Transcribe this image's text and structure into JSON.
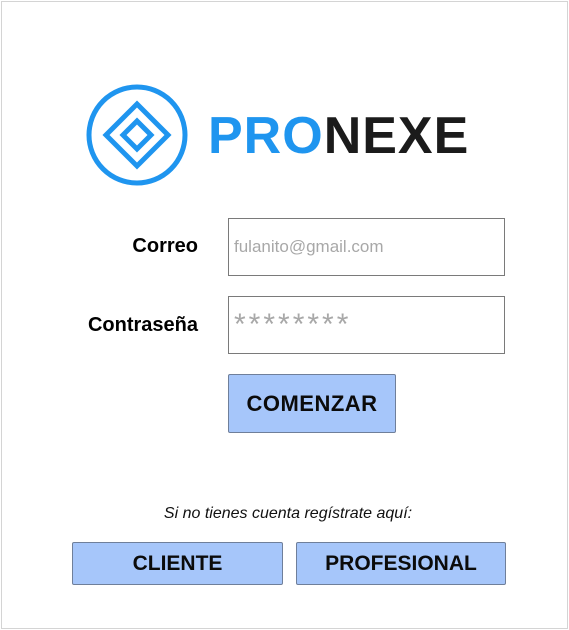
{
  "brand": {
    "name_part1": "PRO",
    "name_part2": "NEXE",
    "logo_icon": "diamond-circle-logo",
    "primary_color": "#1f95ef",
    "dark_color": "#1b1b1b"
  },
  "login": {
    "email_label": "Correo",
    "email_placeholder": "fulanito@gmail.com",
    "email_value": "",
    "password_label": "Contraseña",
    "password_value": "********",
    "submit_label": "COMENZAR"
  },
  "register": {
    "prompt": "Si no tienes cuenta regístrate aquí:",
    "client_label": "CLIENTE",
    "professional_label": "PROFESIONAL"
  },
  "theme": {
    "button_bg": "#a6c6fa",
    "input_border": "#7a7a7a"
  }
}
